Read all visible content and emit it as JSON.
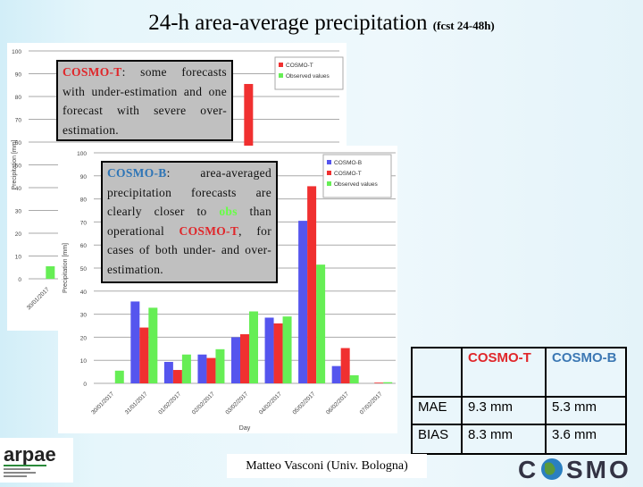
{
  "title": {
    "main": "24-h area-average precipitation",
    "sub": "(fcst 24-48h)"
  },
  "colors": {
    "cosmo_b": "#5555ee",
    "cosmo_t": "#f03030",
    "observed": "#66ee55"
  },
  "chart_data": [
    {
      "type": "bar",
      "ylabel": "Precipitation [mm]",
      "xlabel": "Day",
      "ylim": [
        0,
        100
      ],
      "yticks": [
        "0",
        "10",
        "20",
        "30",
        "40",
        "50",
        "60",
        "70",
        "80",
        "90",
        "100"
      ],
      "categories": [
        "30/01/2017",
        "31/01/2017",
        "01/02/2017",
        "02/02/2017",
        "03/02/2017",
        "04/02/2017",
        "05/02/2017",
        "06/02/2017",
        "07/02/2017"
      ],
      "series": [
        {
          "name": "COSMO-T",
          "values": [
            0,
            24.2,
            5.8,
            11,
            21.3,
            26,
            85.5,
            15.3,
            0.3
          ]
        },
        {
          "name": "Observed values",
          "values": [
            5.5,
            32.8,
            12.5,
            14.8,
            31.2,
            29,
            51.5,
            3.5,
            0.5
          ]
        }
      ],
      "legend": "top-right",
      "grid": true
    },
    {
      "type": "bar",
      "ylabel": "Precipitation [mm]",
      "xlabel": "Day",
      "ylim": [
        0,
        100
      ],
      "yticks": [
        "0",
        "10",
        "20",
        "30",
        "40",
        "50",
        "60",
        "70",
        "80",
        "90",
        "100"
      ],
      "categories": [
        "30/01/2017",
        "31/01/2017",
        "01/02/2017",
        "02/02/2017",
        "03/02/2017",
        "04/02/2017",
        "05/02/2017",
        "06/02/2017",
        "07/02/2017"
      ],
      "series": [
        {
          "name": "COSMO-B",
          "values": [
            0,
            35.5,
            9.3,
            12.5,
            20,
            28.5,
            70.5,
            7.5,
            0
          ]
        },
        {
          "name": "COSMO-T",
          "values": [
            0,
            24.2,
            5.8,
            11,
            21.3,
            26,
            85.5,
            15.3,
            0.3
          ]
        },
        {
          "name": "Observed values",
          "values": [
            5.5,
            32.8,
            12.5,
            14.8,
            31.2,
            29,
            51.5,
            3.5,
            0.5
          ]
        }
      ],
      "legend": "top-right",
      "grid": true
    }
  ],
  "note_t": {
    "name": "COSMO-T",
    "text": ": some forecasts with under-estimation and one forecast with severe over-estimation."
  },
  "note_b": {
    "name": "COSMO-B",
    "text1": ": area-averaged precipitation forecasts are clearly closer to ",
    "obs": "obs",
    "text2": " than operational ",
    "cosmo_t": "COSMO-T",
    "text3": ", for cases of both under- and over-estimation."
  },
  "table": {
    "headers": [
      "",
      "COSMO-T",
      "COSMO-B"
    ],
    "rows": [
      [
        "MAE",
        "9.3 mm",
        "5.3 mm"
      ],
      [
        "BIAS",
        "8.3 mm",
        "3.6 mm"
      ]
    ]
  },
  "author": "Matteo Vasconi (Univ. Bologna)",
  "logos": {
    "left": "arpae",
    "right": "COSMO"
  }
}
